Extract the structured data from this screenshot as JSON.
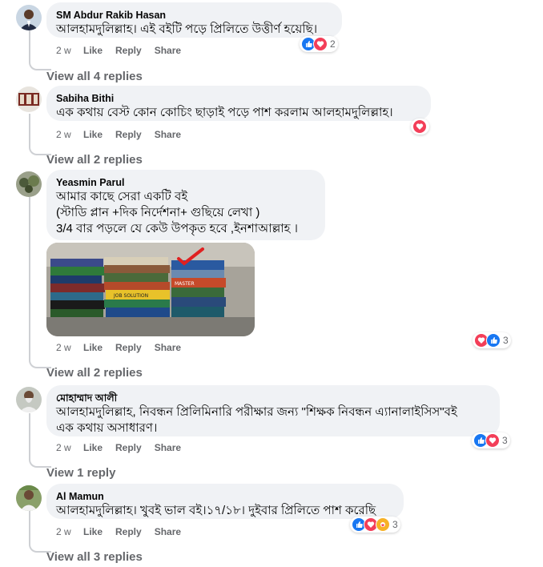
{
  "actions": {
    "like": "Like",
    "reply": "Reply",
    "share": "Share"
  },
  "comments": [
    {
      "author": "SM Abdur Rakib Hasan",
      "text": "আলহামদুলিল্লাহ। এই বইটি পড়ে প্রিলিতে উত্তীর্ণ হয়েছি।",
      "time": "2 w",
      "reactions": {
        "icons": [
          "like-icon",
          "love-icon"
        ],
        "count": "2"
      },
      "view_replies": "View all 4 replies"
    },
    {
      "author": "Sabiha Bithi",
      "text": "এক কথায় বেস্ট কোন কোচিং ছাড়াই পড়ে পাশ করলাম আলহামদুলিল্লাহ।",
      "time": "2 w",
      "reactions": {
        "icons": [
          "love-icon"
        ],
        "count": ""
      },
      "view_replies": "View all 2 replies"
    },
    {
      "author": "Yeasmin Parul",
      "text": "আমার কাছে সেরা একটি বই\n(স্টাডি প্লান +দিক নির্দেশনা+ গুছিয়ে লেখা )\n3/4 বার পড়লে যে কেউ উপকৃত হবে ,ইনশাআল্লাহ ।",
      "time": "2 w",
      "reactions": {
        "icons": [
          "love-icon",
          "like-icon"
        ],
        "count": "3"
      },
      "view_replies": "View all 2 replies"
    },
    {
      "author": "মোহাম্মাদ আলী",
      "text": "আলহামদুলিল্লাহ, নিবন্ধন প্রিলিমিনারি পরীক্ষার জন্য \"শিক্ষক নিবন্ধন এ্যানালাইসিস\"বই\nএক কথায় অসাধারণ।",
      "time": "2 w",
      "reactions": {
        "icons": [
          "like-icon",
          "love-icon"
        ],
        "count": "3"
      },
      "view_replies": "View 1 reply"
    },
    {
      "author": "Al Mamun",
      "text": "আলহামদুলিল্লাহ। খুবই ভাল বই।১৭/১৮। দুইবার প্রিলিতে পাশ করেছি",
      "time": "2 w",
      "reactions": {
        "icons": [
          "like-icon",
          "love-icon",
          "care-icon"
        ],
        "count": "3"
      },
      "view_replies": "View all 3 replies"
    }
  ],
  "photo_labels": {
    "book_a": "JOB SOLUTION",
    "book_b": "MASTER"
  },
  "colors": {
    "like": "#1877f2",
    "love": "#f33e58",
    "care": "#f7b125",
    "secondary_text": "#65676b",
    "bubble": "#f0f2f5"
  }
}
